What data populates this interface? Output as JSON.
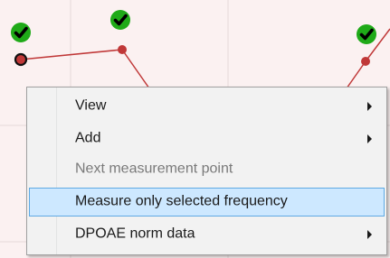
{
  "context_menu": {
    "items": [
      {
        "label": "View",
        "has_submenu": true,
        "enabled": true,
        "highlighted": false
      },
      {
        "label": "Add",
        "has_submenu": true,
        "enabled": true,
        "highlighted": false
      },
      {
        "label": "Next measurement point",
        "has_submenu": false,
        "enabled": false,
        "highlighted": false
      },
      {
        "label": "Measure only selected  frequency",
        "has_submenu": false,
        "enabled": true,
        "highlighted": true
      },
      {
        "label": "DPOAE norm data",
        "has_submenu": true,
        "enabled": true,
        "highlighted": false
      }
    ]
  },
  "chart": {
    "background_color": "#fbf1f1",
    "grid_color": "#e6d9d9",
    "line_color": "#c03838",
    "point_color": "#c03838",
    "checkmark_color": "#1faa18",
    "icons": [
      "checkmark-icon",
      "measurement-point-icon"
    ]
  }
}
